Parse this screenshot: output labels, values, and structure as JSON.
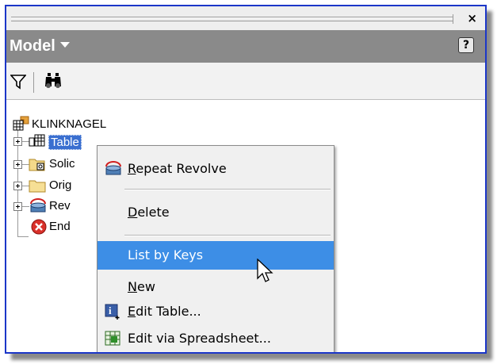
{
  "panel": {
    "title": "Model",
    "help_label": "?",
    "close_label": "×"
  },
  "toolbar": {
    "filter_icon": "filter-icon",
    "find_icon": "binoculars-icon"
  },
  "tree": {
    "root": "KLINKNAGEL",
    "items": [
      {
        "label": "Table",
        "icon": "table-icon"
      },
      {
        "label": "Solic",
        "icon": "solid-bodies-icon"
      },
      {
        "label": "Orig",
        "icon": "folder-icon"
      },
      {
        "label": "Rev",
        "icon": "revolve-icon"
      },
      {
        "label": "End",
        "icon": "end-of-part-icon"
      }
    ]
  },
  "context_menu": {
    "items": [
      {
        "label_first": "R",
        "label_rest": "epeat Revolve",
        "icon": "revolve-icon"
      },
      {
        "label_first": "D",
        "label_rest": "elete"
      },
      {
        "label": "List by Keys",
        "highlighted": true
      },
      {
        "label_first": "N",
        "label_rest": "ew"
      },
      {
        "label_first": "E",
        "label_rest": "dit Table...",
        "icon": "info-icon"
      },
      {
        "label": "Edit via Spreadsheet...",
        "icon": "spreadsheet-icon"
      }
    ]
  },
  "colors": {
    "frame_border": "#1b36c8",
    "header_bg": "#8a8a8a",
    "selection": "#3a6fd0",
    "menu_highlight": "#3d8ee6"
  }
}
